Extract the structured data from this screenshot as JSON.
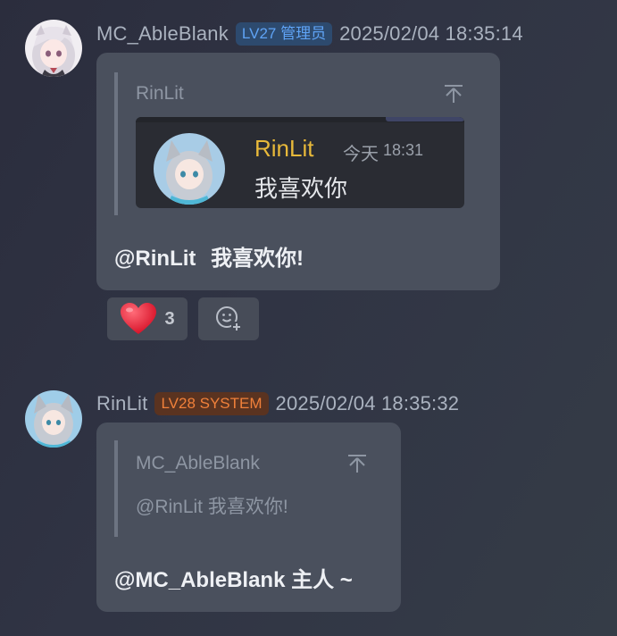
{
  "messages": [
    {
      "username": "MC_AbleBlank",
      "badge": "LV27 管理员",
      "timestamp": "2025/02/04 18:35:14",
      "quote": {
        "author": "RinLit",
        "embed": {
          "username": "RinLit",
          "day": "今天",
          "time": "18:31",
          "text": "我喜欢你"
        }
      },
      "mention": "@RinLit",
      "text": "我喜欢你!",
      "reactions": [
        {
          "icon": "heart-icon",
          "count": "3"
        },
        {
          "icon": "add-reaction-icon"
        }
      ]
    },
    {
      "username": "RinLit",
      "badge": "LV28 SYSTEM",
      "timestamp": "2025/02/04 18:35:32",
      "quote": {
        "author": "MC_AbleBlank",
        "text": "@RinLit 我喜欢你!"
      },
      "text": "@MC_AbleBlank 主人 ~"
    }
  ],
  "colors": {
    "badge_admin": "#5fa3f5",
    "badge_system": "#f0803a",
    "embed_username": "#e8b93a"
  }
}
